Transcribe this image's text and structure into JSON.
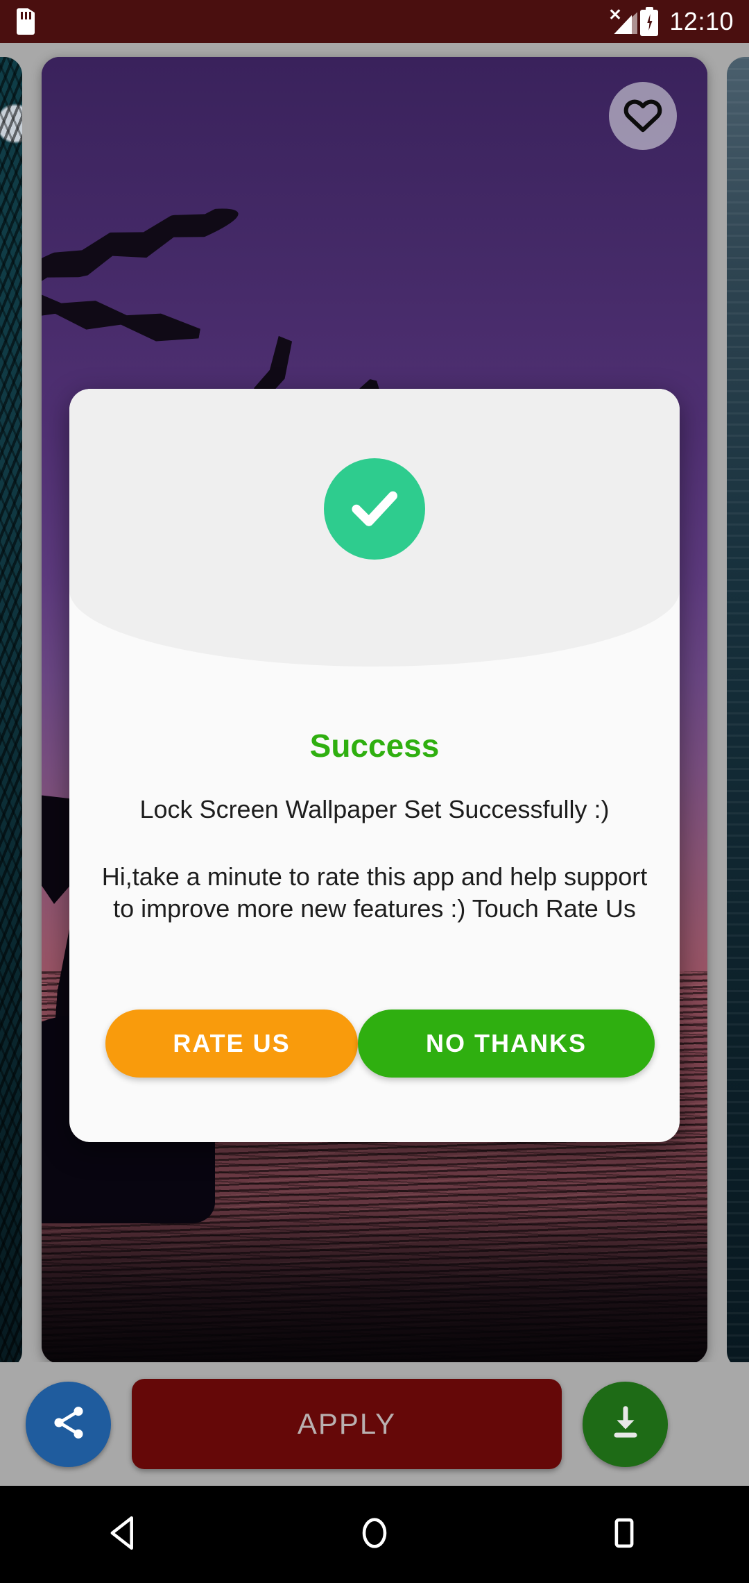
{
  "status_bar": {
    "sd_card_icon": "sd-card-icon",
    "signal_icon": "no-signal-icon",
    "battery_icon": "battery-charging-icon",
    "time": "12:10",
    "background_color": "#4a0f0f"
  },
  "wallpaper_preview": {
    "favorite_icon": "heart-outline-icon",
    "description": "Purple sunset sky with palm silhouettes over dark red water",
    "sky_top_color": "#3a225c",
    "sky_bottom_color": "#9c5362",
    "water_color": "#7e4450"
  },
  "action_bar": {
    "share_icon": "share-icon",
    "apply_label": "APPLY",
    "apply_color": "#650808",
    "download_icon": "download-icon",
    "share_color": "#1f5c9e",
    "download_color": "#1e6b16"
  },
  "dialog": {
    "success_icon": "checkmark-icon",
    "success_circle_color": "#2ECC8E",
    "title": "Success",
    "title_color": "#2faf10",
    "subtitle": "Lock Screen Wallpaper Set Successfully :)",
    "message": "Hi,take a minute to rate this app and help support to improve more new features :) Touch Rate Us",
    "buttons": [
      {
        "label": "RATE US",
        "color": "#F99B0C"
      },
      {
        "label": "NO THANKS",
        "color": "#2faf10"
      }
    ]
  },
  "nav_bar": {
    "back_icon": "back-triangle-icon",
    "home_icon": "home-circle-icon",
    "recents_icon": "recents-square-icon"
  }
}
